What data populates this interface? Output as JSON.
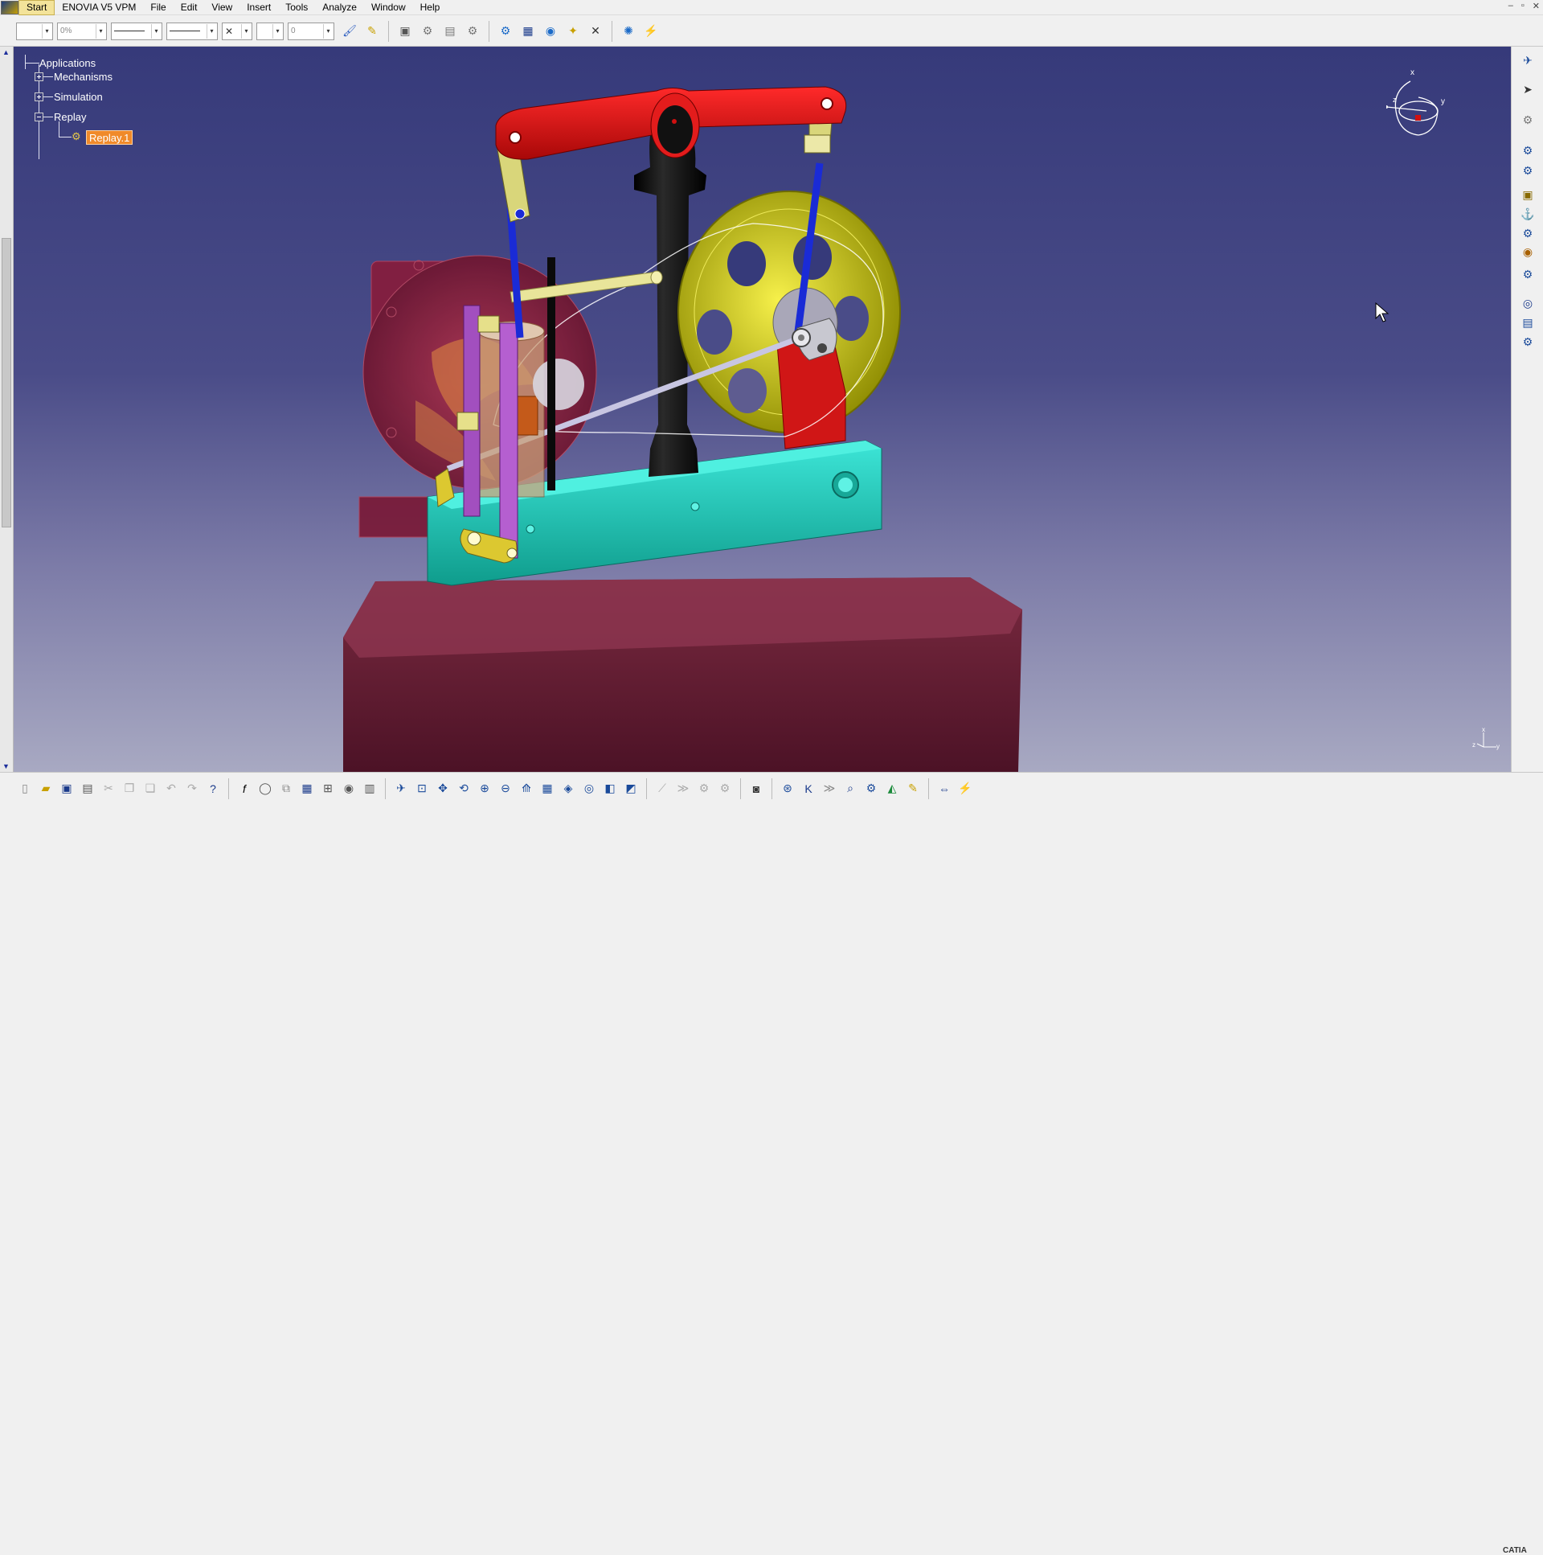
{
  "menubar": {
    "items": [
      "Start",
      "ENOVIA V5 VPM",
      "File",
      "Edit",
      "View",
      "Insert",
      "Tools",
      "Analyze",
      "Window",
      "Help"
    ],
    "active_index": 0
  },
  "window_controls": [
    "–",
    "▫",
    "✕"
  ],
  "top_toolbar": {
    "combos": [
      {
        "value": ""
      },
      {
        "value": "0%"
      },
      {
        "value": ""
      },
      {
        "value": ""
      },
      {
        "value": "✕"
      },
      {
        "value": ""
      },
      {
        "value": "0"
      }
    ]
  },
  "tree": {
    "root": "Applications",
    "children": [
      "Mechanisms",
      "Simulation",
      "Replay"
    ],
    "replay_child": "Replay.1"
  },
  "compass": {
    "x": "x",
    "y": "y",
    "z": "z"
  },
  "axis_triad": {
    "x": "x",
    "y": "y",
    "z": "z"
  },
  "colors": {
    "viewport_top": "#363a7a",
    "viewport_bottom": "#a8a9c2",
    "beam": "#d41515",
    "column": "#111111",
    "flywheel": "#c8c400",
    "base": "#1db3a6",
    "platform": "#6e1f34",
    "housing": "#8a1a38",
    "rod_blue": "#1a2bd6",
    "link_purple": "#a24fbf",
    "pivot_yellow": "#e6e08a",
    "selected": "#f08a2a"
  },
  "brand": "CATIA"
}
